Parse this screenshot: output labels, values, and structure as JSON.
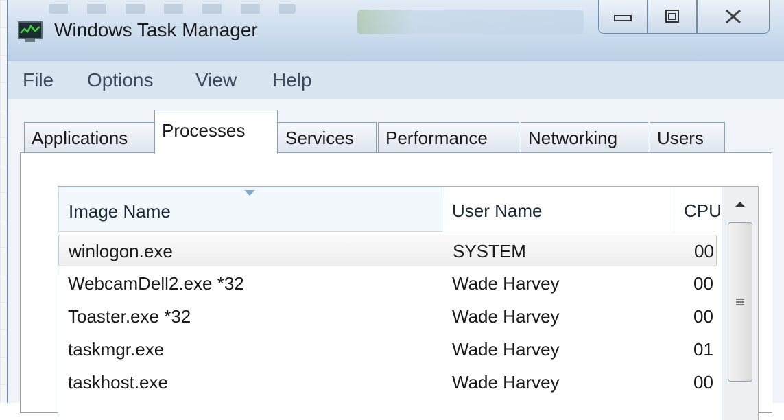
{
  "window": {
    "title": "Windows Task Manager",
    "minimize_symbol": "▭",
    "maximize_symbol": "◻",
    "close_symbol": "X"
  },
  "menu": {
    "items": [
      "File",
      "Options",
      "View",
      "Help"
    ]
  },
  "tabs": [
    {
      "label": "Applications"
    },
    {
      "label": "Processes",
      "active": true
    },
    {
      "label": "Services"
    },
    {
      "label": "Performance"
    },
    {
      "label": "Networking"
    },
    {
      "label": "Users"
    }
  ],
  "table": {
    "columns": [
      "Image Name",
      "User Name",
      "CPU"
    ],
    "sorted_column": "Image Name",
    "rows": [
      {
        "image": "winlogon.exe",
        "user": "SYSTEM",
        "cpu": "00",
        "selected": true
      },
      {
        "image": "WebcamDell2.exe *32",
        "user": "Wade Harvey",
        "cpu": "00"
      },
      {
        "image": "Toaster.exe *32",
        "user": "Wade Harvey",
        "cpu": "00"
      },
      {
        "image": "taskmgr.exe",
        "user": "Wade Harvey",
        "cpu": "01"
      },
      {
        "image": "taskhost.exe",
        "user": "Wade Harvey",
        "cpu": "00"
      }
    ]
  },
  "icons": {
    "app": "task-manager-icon",
    "scroll_up": "chevron-up-icon",
    "thumb_grip": "grip-icon"
  }
}
